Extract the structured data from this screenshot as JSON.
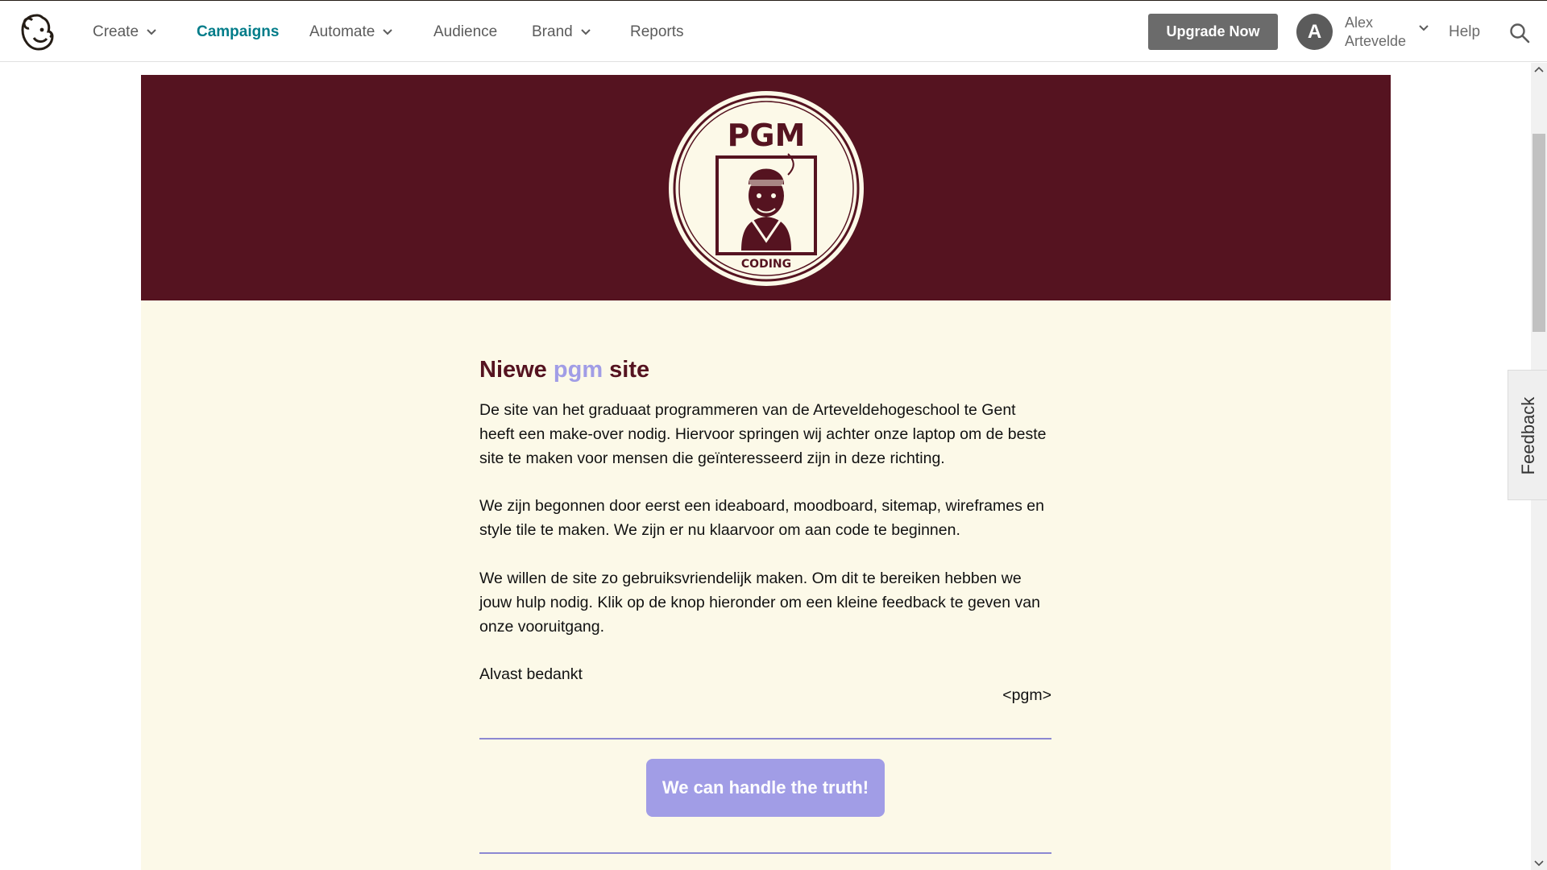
{
  "nav": {
    "items": [
      {
        "label": "Create",
        "has_dropdown": true
      },
      {
        "label": "Campaigns",
        "active": true
      },
      {
        "label": "Automate",
        "has_dropdown": true
      },
      {
        "label": "Audience"
      },
      {
        "label": "Brand",
        "has_dropdown": true
      },
      {
        "label": "Reports"
      }
    ],
    "upgrade_label": "Upgrade Now",
    "user": {
      "initial": "A",
      "first_name": "Alex",
      "last_name": "Artevelde"
    },
    "help_label": "Help",
    "icons": {
      "logo": "mailchimp-freddie-logo",
      "search": "search-icon",
      "caret": "chevron-down-icon"
    }
  },
  "email": {
    "badge": {
      "top_text": "PGM",
      "bottom_text": "CODING"
    },
    "headline": {
      "before": "Niewe",
      "accent": "pgm",
      "after": "site"
    },
    "paragraphs": [
      "De site van het graduaat programmeren van de Arteveldehogeschool te Gent heeft een make-over nodig. Hiervoor springen wij achter onze laptop om de beste site te maken voor mensen die geïnteresseerd zijn in deze richting.",
      "We zijn begonnen door eerst een ideaboard, moodboard, sitemap, wireframes en style tile te maken. We zijn er nu klaarvoor om aan code te beginnen.",
      "We willen de site zo gebruiksvriendelijk maken. Om dit te bereiken hebben we jouw hulp nodig. Klik op de knop hieronder om een kleine feedback te geven van onze vooruitgang.",
      "Alvast bedankt"
    ],
    "signature": "<pgm>",
    "cta_label": "We can handle the truth!"
  },
  "feedback_tab": {
    "label": "Feedback"
  },
  "colors": {
    "hero": "#551320",
    "cream": "#fcf9e8",
    "accent": "#a19de6",
    "nav_active": "#007c89",
    "upgrade": "#6b6b6b"
  }
}
